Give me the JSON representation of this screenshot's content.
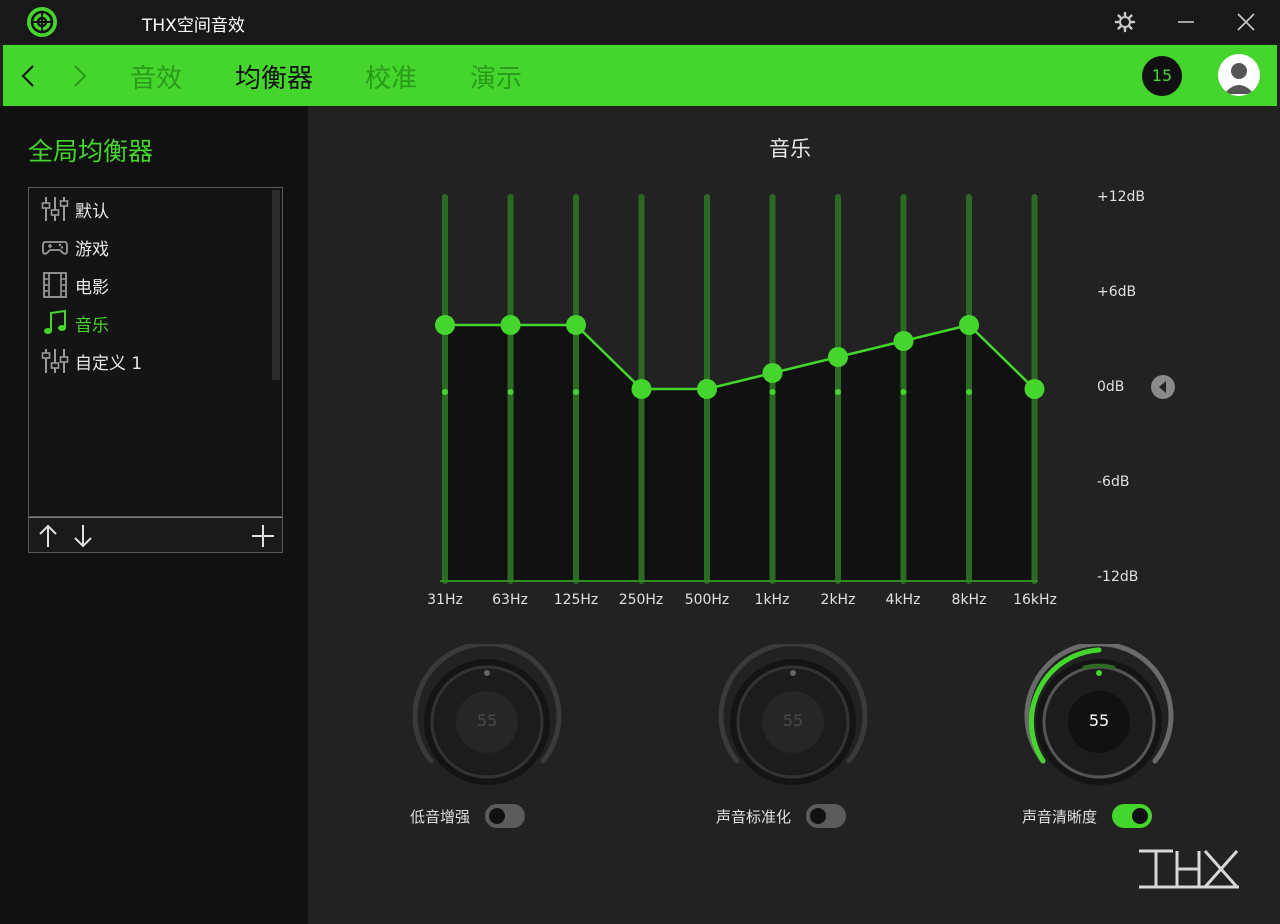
{
  "window": {
    "title": "THX空间音效"
  },
  "nav": {
    "tabs": [
      {
        "label": "音效",
        "active": false
      },
      {
        "label": "均衡器",
        "active": true
      },
      {
        "label": "校准",
        "active": false
      },
      {
        "label": "演示",
        "active": false
      }
    ],
    "notification_count": "15"
  },
  "sidebar": {
    "title": "全局均衡器",
    "presets": [
      {
        "label": "默认",
        "icon": "sliders-icon",
        "active": false
      },
      {
        "label": "游戏",
        "icon": "gamepad-icon",
        "active": false
      },
      {
        "label": "电影",
        "icon": "film-icon",
        "active": false
      },
      {
        "label": "音乐",
        "icon": "music-note-icon",
        "active": true
      },
      {
        "label": "自定义 1",
        "icon": "sliders-icon",
        "active": false
      }
    ]
  },
  "equalizer": {
    "title": "音乐",
    "db_labels": [
      "+12dB",
      "+6dB",
      "0dB",
      "-6dB",
      "-12dB"
    ],
    "bands": [
      {
        "label": "31Hz",
        "gain_db": 4
      },
      {
        "label": "63Hz",
        "gain_db": 4
      },
      {
        "label": "125Hz",
        "gain_db": 4
      },
      {
        "label": "250Hz",
        "gain_db": 0
      },
      {
        "label": "500Hz",
        "gain_db": 0
      },
      {
        "label": "1kHz",
        "gain_db": 1
      },
      {
        "label": "2kHz",
        "gain_db": 2
      },
      {
        "label": "4kHz",
        "gain_db": 3
      },
      {
        "label": "8kHz",
        "gain_db": 4
      },
      {
        "label": "16kHz",
        "gain_db": 0
      }
    ],
    "range_db": [
      -12,
      12
    ]
  },
  "controls": {
    "bass": {
      "label": "低音增强",
      "value": "55",
      "enabled": false
    },
    "normalization": {
      "label": "声音标准化",
      "value": "55",
      "enabled": false
    },
    "clarity": {
      "label": "声音清晰度",
      "value": "55",
      "enabled": true
    }
  },
  "colors": {
    "accent": "#44d62c",
    "background": "#222222",
    "sidebar": "#111111"
  }
}
